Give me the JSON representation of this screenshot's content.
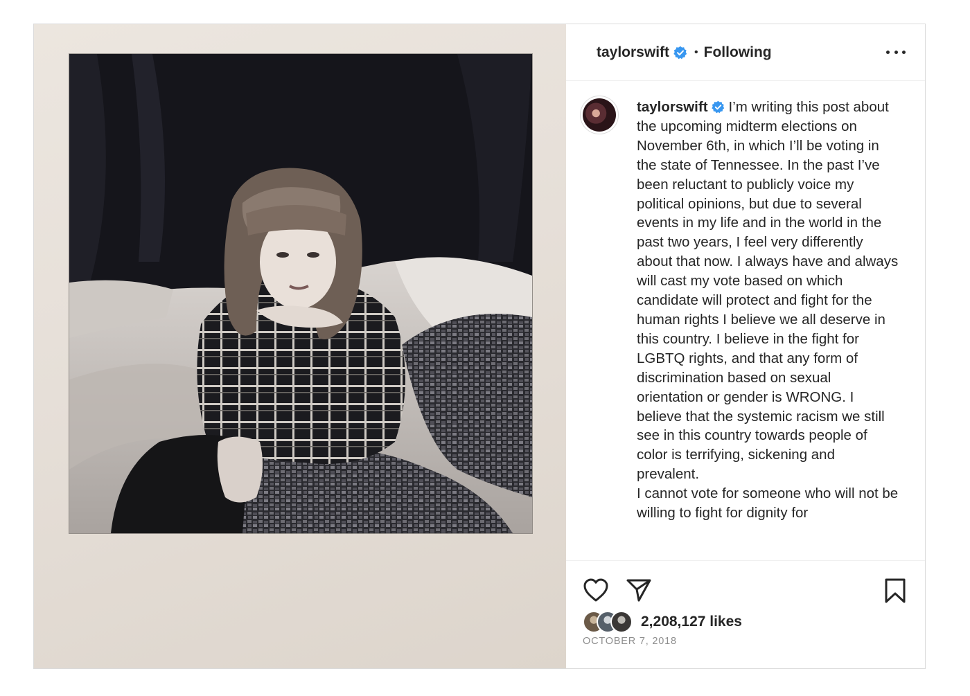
{
  "header": {
    "username": "taylorswift",
    "separator": "•",
    "follow_state": "Following"
  },
  "icons": {
    "verified": "verified-badge-icon",
    "more": "more-options-icon",
    "like": "heart-icon",
    "share": "paper-plane-icon",
    "save": "bookmark-icon"
  },
  "colors": {
    "verified_blue": "#3897f0",
    "text": "#262626",
    "muted": "#8e8e8e",
    "border": "#dbdbdb"
  },
  "caption": {
    "username": "taylorswift",
    "paragraph1": "I’m writing this post about the upcoming midterm elections on November 6th, in which I’ll be voting in the state of Tennessee. In the past I’ve been reluctant to publicly voice my political opinions, but due to several events in my life and in the world in the past two years, I feel very differently about that now. I always have and always will cast my vote based on which candidate will protect and fight for the human rights I believe we all deserve in this country. I believe in the fight for LGBTQ rights, and that any form of discrimination based on sexual orientation or gender is WRONG. I believe that the systemic racism we still see in this country towards people of color is terrifying, sickening and prevalent.",
    "paragraph2": "I cannot vote for someone who will not be willing to fight for dignity for"
  },
  "engagement": {
    "likes": "2,208,127 likes",
    "date": "OCTOBER 7, 2018"
  }
}
